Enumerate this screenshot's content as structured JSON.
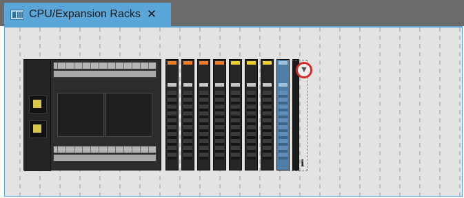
{
  "tab": {
    "title": "CPU/Expansion Racks",
    "close_glyph": "✕",
    "icon": "rack-icon"
  },
  "rack": {
    "info_glyph": "i",
    "add_glyph": "▼",
    "colors": {
      "accent": "#5aa6d8",
      "highlight": "#d42a2a"
    }
  }
}
